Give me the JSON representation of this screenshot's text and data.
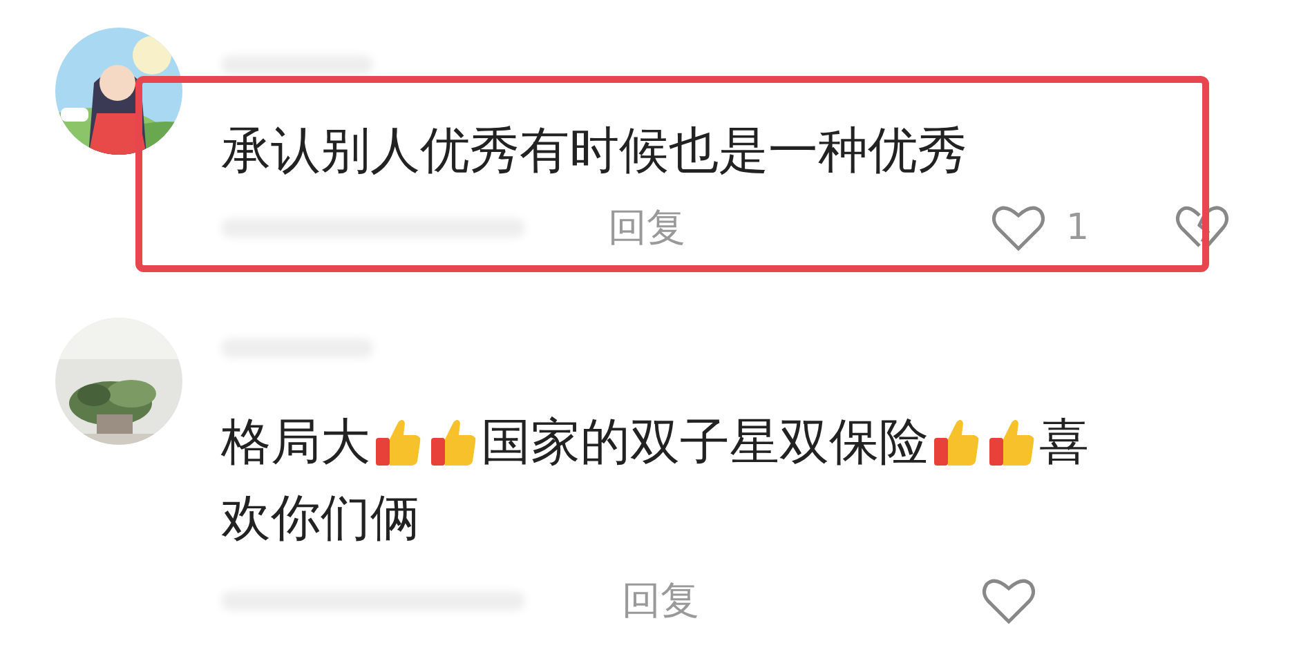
{
  "comments": [
    {
      "highlighted": true,
      "content": [
        {
          "kind": "text",
          "text": "承认别人优秀有时候也是一种优秀"
        }
      ],
      "reply": "回复",
      "likes": "1",
      "dislike": true
    },
    {
      "highlighted": false,
      "content": [
        {
          "kind": "text",
          "text": "格局大"
        },
        {
          "kind": "thumbs"
        },
        {
          "kind": "thumbs"
        },
        {
          "kind": "text",
          "text": "国家的双子星双保险"
        },
        {
          "kind": "thumbs"
        },
        {
          "kind": "thumbs"
        },
        {
          "kind": "text",
          "text": "喜"
        },
        {
          "kind": "text",
          "text": "欢你们俩"
        }
      ],
      "reply": "回复",
      "dislike": false
    }
  ]
}
